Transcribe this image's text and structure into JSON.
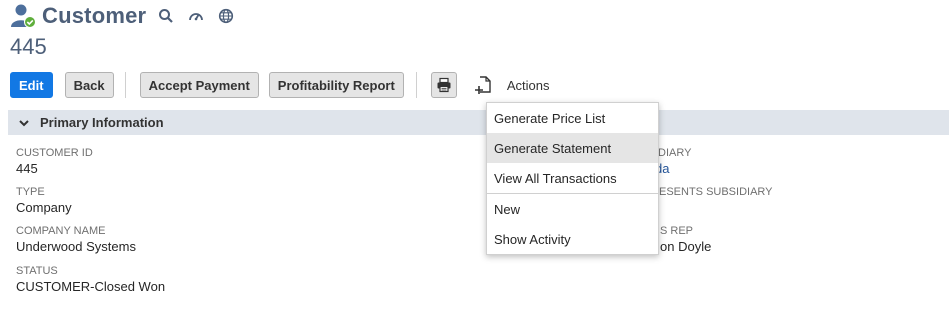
{
  "header": {
    "title": "Customer",
    "record_id": "445"
  },
  "toolbar": {
    "edit_label": "Edit",
    "back_label": "Back",
    "accept_payment_label": "Accept Payment",
    "profitability_report_label": "Profitability Report",
    "actions_label": "Actions"
  },
  "section": {
    "title": "Primary Information"
  },
  "fields": {
    "customer_id": {
      "label": "CUSTOMER ID",
      "value": "445"
    },
    "type": {
      "label": "TYPE",
      "value": "Company"
    },
    "company_name": {
      "label": "COMPANY NAME",
      "value": "Underwood Systems"
    },
    "status": {
      "label": "STATUS",
      "value": "CUSTOMER-Closed Won"
    },
    "subsidiary": {
      "label_partial": "IDIARY",
      "value_partial": "da"
    },
    "represents_subsidiary": {
      "label_partial": "ESENTS SUBSIDIARY"
    },
    "sales_rep": {
      "label_partial": "S REP",
      "value_partial": "on Doyle"
    }
  },
  "actions_menu": {
    "items": [
      "Generate Price List",
      "Generate Statement",
      "View All Transactions",
      "New",
      "Show Activity"
    ],
    "hovered_index": 1
  },
  "colors": {
    "title": "#4d5f79",
    "primary_button": "#1278e4",
    "section_bar": "#dfe4eb",
    "link": "#255599"
  },
  "icons": [
    "customer-record-icon",
    "search-icon",
    "dashboard-icon",
    "globe-icon",
    "print-icon",
    "new-document-icon",
    "chevron-down-icon"
  ]
}
